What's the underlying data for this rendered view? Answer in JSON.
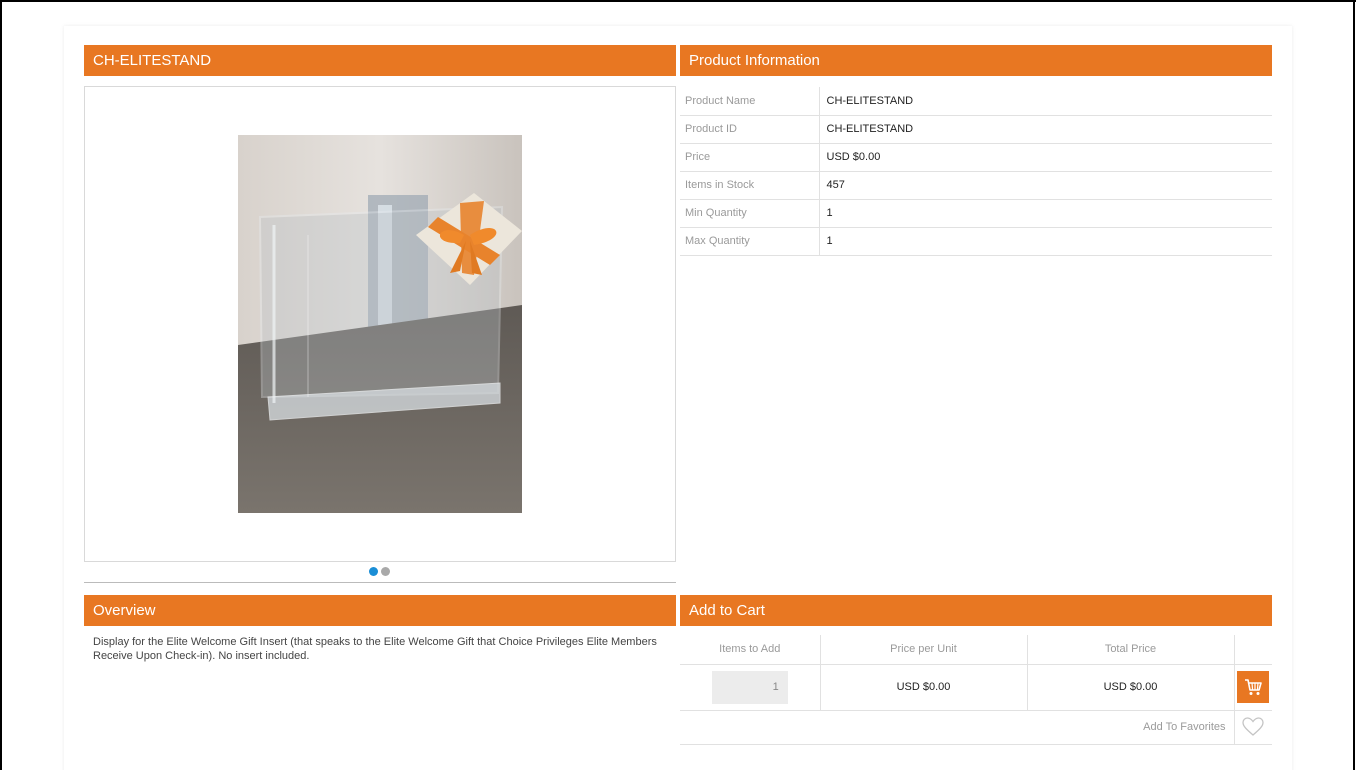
{
  "product": {
    "title": "CH-ELITESTAND"
  },
  "carousel": {
    "slide_count": 2,
    "active_index": 0,
    "accent_color": "#1a8ed6"
  },
  "info": {
    "header": "Product Information",
    "rows": [
      {
        "label": "Product Name",
        "value": "CH-ELITESTAND"
      },
      {
        "label": "Product ID",
        "value": "CH-ELITESTAND"
      },
      {
        "label": "Price",
        "value": "USD $0.00"
      },
      {
        "label": "Items in Stock",
        "value": "457"
      },
      {
        "label": "Min Quantity",
        "value": "1"
      },
      {
        "label": "Max Quantity",
        "value": "1"
      }
    ]
  },
  "overview": {
    "header": "Overview",
    "text": "Display for the Elite Welcome Gift Insert (that speaks to the Elite Welcome Gift that Choice Privileges Elite Members Receive Upon Check-in). No insert included."
  },
  "cart": {
    "header": "Add to Cart",
    "columns": [
      "Items to Add",
      "Price per Unit",
      "Total Price"
    ],
    "quantity": "1",
    "price_per_unit": "USD $0.00",
    "total_price": "USD $0.00",
    "add_to_cart_icon": "shopping-cart-icon",
    "favorites_label": "Add To Favorites",
    "favorites_icon": "heart-icon"
  },
  "theme": {
    "accent": "#e87722"
  }
}
